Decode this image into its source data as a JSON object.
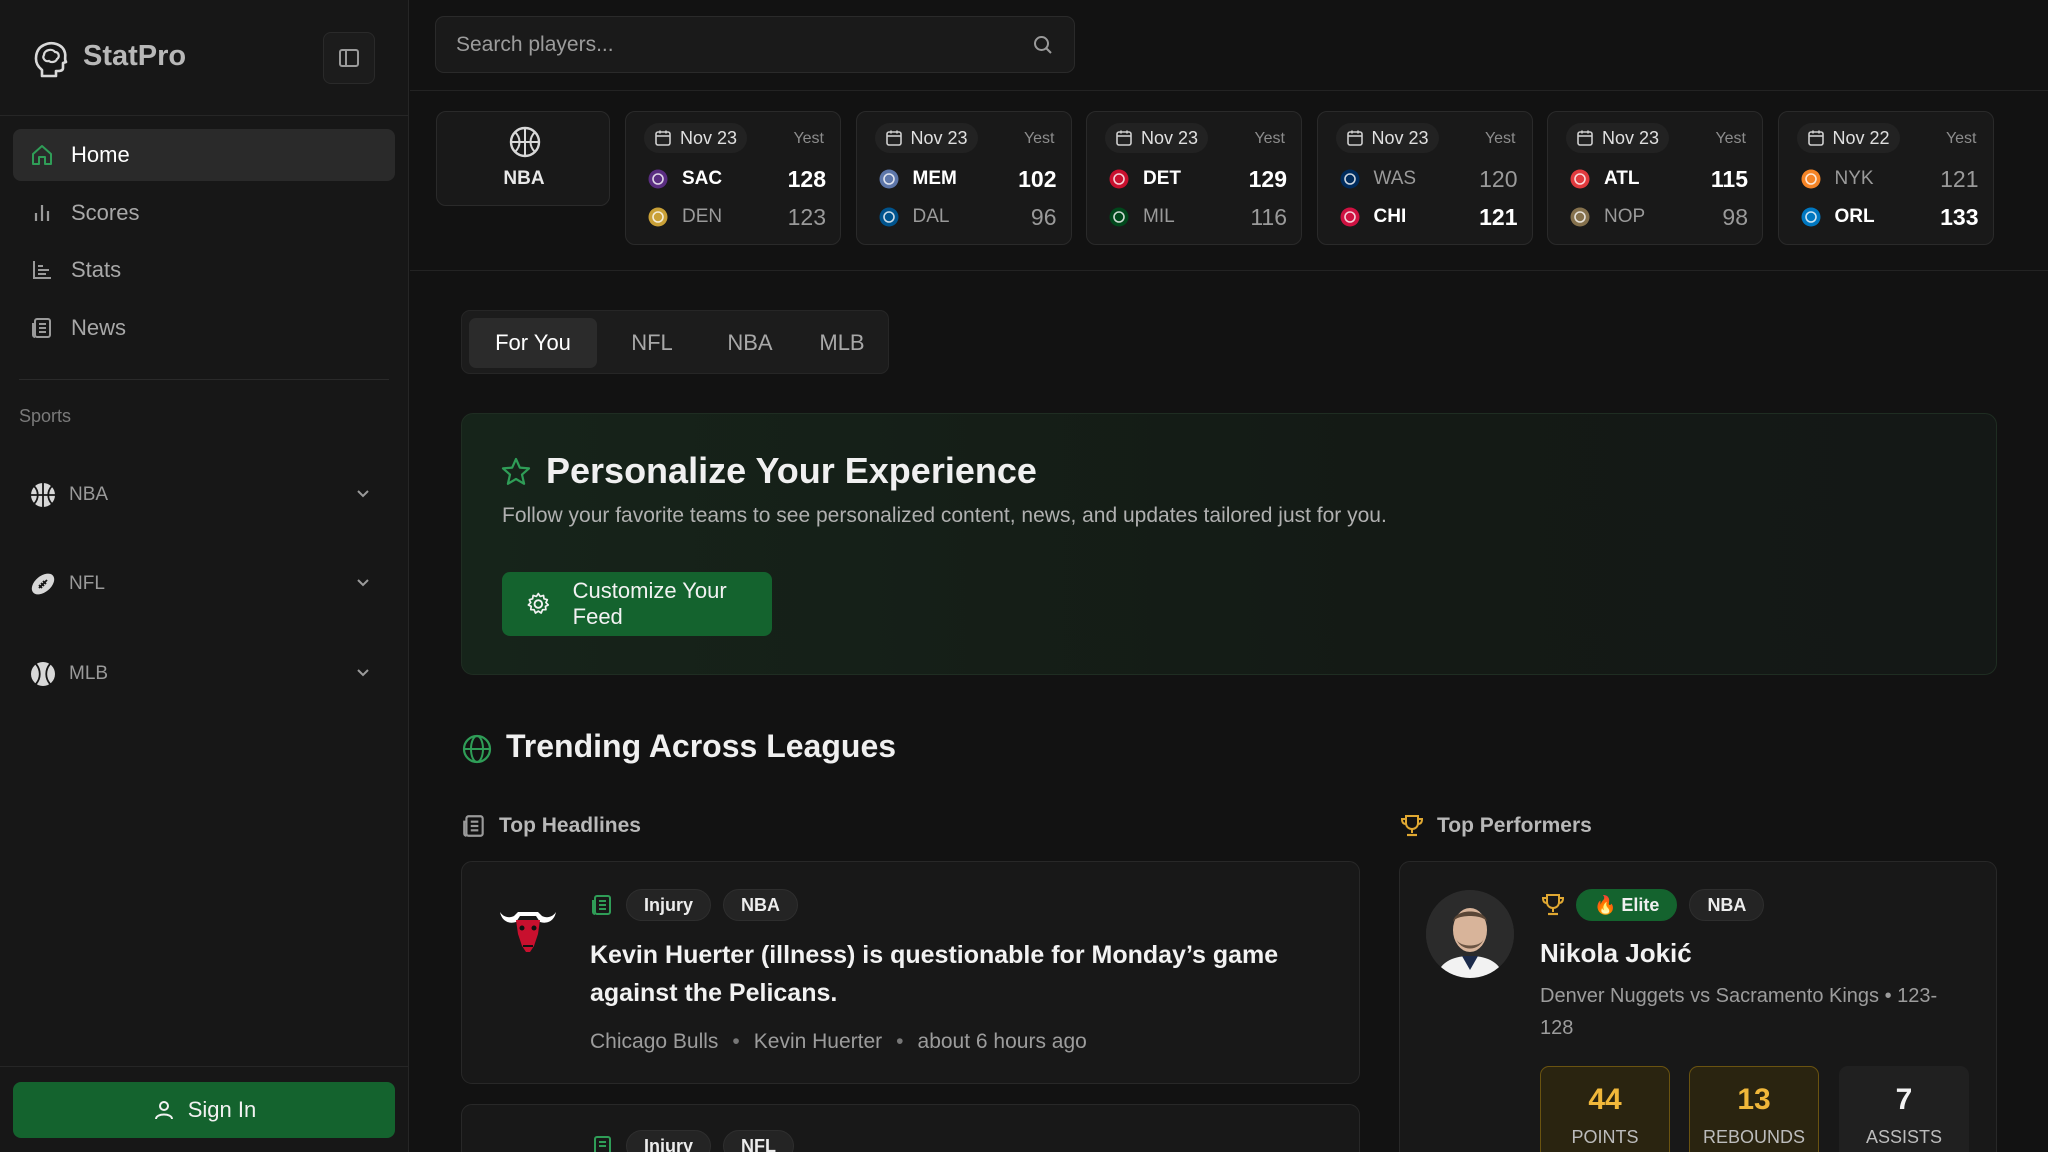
{
  "app": {
    "name": "StatPro"
  },
  "sidebar": {
    "nav": [
      {
        "label": "Home",
        "icon": "home-icon",
        "active": true
      },
      {
        "label": "Scores",
        "icon": "bar-chart-icon"
      },
      {
        "label": "Stats",
        "icon": "stats-chart-icon"
      },
      {
        "label": "News",
        "icon": "newspaper-icon"
      }
    ],
    "section_label": "Sports",
    "sports": [
      {
        "label": "NBA",
        "icon": "basketball-icon"
      },
      {
        "label": "NFL",
        "icon": "football-icon"
      },
      {
        "label": "MLB",
        "icon": "baseball-icon"
      }
    ],
    "sign_in": "Sign In"
  },
  "search": {
    "placeholder": "Search players..."
  },
  "scores": {
    "league": "NBA",
    "games": [
      {
        "date": "Nov 23",
        "when": "Yest",
        "home": {
          "abbr": "SAC",
          "score": "128",
          "win": true,
          "color": "#5a2d81"
        },
        "away": {
          "abbr": "DEN",
          "score": "123",
          "win": false,
          "color": "#c9a037"
        }
      },
      {
        "date": "Nov 23",
        "when": "Yest",
        "home": {
          "abbr": "MEM",
          "score": "102",
          "win": true,
          "color": "#5d76a9"
        },
        "away": {
          "abbr": "DAL",
          "score": "96",
          "win": false,
          "color": "#00538c"
        }
      },
      {
        "date": "Nov 23",
        "when": "Yest",
        "home": {
          "abbr": "DET",
          "score": "129",
          "win": true,
          "color": "#c8102e"
        },
        "away": {
          "abbr": "MIL",
          "score": "116",
          "win": false,
          "color": "#00471b"
        }
      },
      {
        "date": "Nov 23",
        "when": "Yest",
        "home": {
          "abbr": "WAS",
          "score": "120",
          "win": false,
          "color": "#002b5c"
        },
        "away": {
          "abbr": "CHI",
          "score": "121",
          "win": true,
          "color": "#ce1141"
        }
      },
      {
        "date": "Nov 23",
        "when": "Yest",
        "home": {
          "abbr": "ATL",
          "score": "115",
          "win": true,
          "color": "#e03a3e"
        },
        "away": {
          "abbr": "NOP",
          "score": "98",
          "win": false,
          "color": "#85714d"
        }
      },
      {
        "date": "Nov 22",
        "when": "Yest",
        "home": {
          "abbr": "NYK",
          "score": "121",
          "win": false,
          "color": "#f58426"
        },
        "away": {
          "abbr": "ORL",
          "score": "133",
          "win": true,
          "color": "#0077c0"
        }
      }
    ]
  },
  "tabs": [
    "For You",
    "NFL",
    "NBA",
    "MLB"
  ],
  "personalize": {
    "title": "Personalize Your Experience",
    "subtitle": "Follow your favorite teams to see personalized content, news, and updates tailored just for you.",
    "button": "Customize Your Feed"
  },
  "trending": {
    "title": "Trending Across Leagues",
    "headlines_label": "Top Headlines",
    "performers_label": "Top Performers",
    "headlines": [
      {
        "tags": [
          "Injury",
          "NBA"
        ],
        "title": "Kevin Huerter (illness) is questionable for Monday’s game against the Pelicans.",
        "team": "Chicago Bulls",
        "player": "Kevin Huerter",
        "time": "about 6 hours ago"
      },
      {
        "tags": [
          "Injury",
          "NFL"
        ]
      }
    ],
    "performer": {
      "badge": "🔥 Elite",
      "league": "NBA",
      "name": "Nikola Jokić",
      "desc": "Denver Nuggets vs Sacramento Kings • 123-128",
      "stats": [
        {
          "value": "44",
          "label": "POINTS"
        },
        {
          "value": "13",
          "label": "REBOUNDS"
        },
        {
          "value": "7",
          "label": "ASSISTS"
        }
      ]
    }
  },
  "colors": {
    "accent": "#14632e",
    "gold": "#f0b73a",
    "background": "#121212"
  }
}
